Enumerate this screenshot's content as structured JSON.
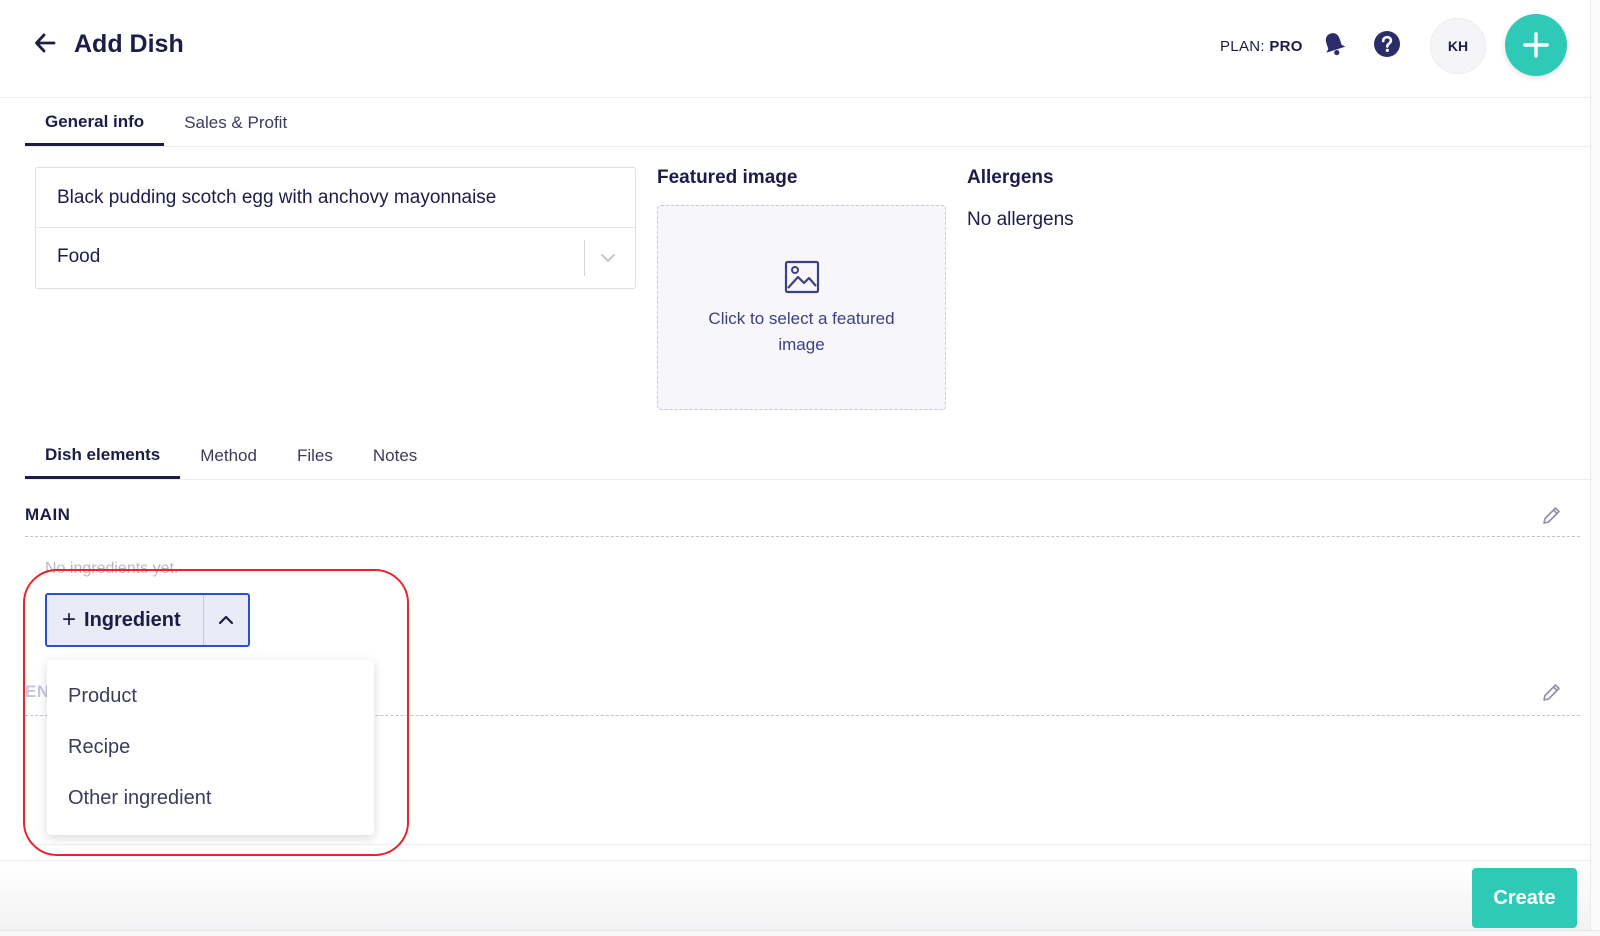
{
  "header": {
    "title": "Add Dish",
    "plan_label": "PLAN:",
    "plan_value": "PRO",
    "avatar_initials": "KH",
    "icons": [
      "back-arrow-icon",
      "bell-icon",
      "help-icon",
      "plus-icon"
    ]
  },
  "top_tabs": [
    {
      "label": "General info",
      "active": true
    },
    {
      "label": "Sales & Profit",
      "active": false
    }
  ],
  "form": {
    "dish_name": "Black pudding scotch egg with anchovy mayonnaise",
    "dish_type": "Food"
  },
  "featured_image": {
    "title": "Featured image",
    "prompt": "Click to select a featured image"
  },
  "allergens": {
    "title": "Allergens",
    "value": "No allergens"
  },
  "element_tabs": [
    {
      "label": "Dish elements",
      "active": true
    },
    {
      "label": "Method",
      "active": false
    },
    {
      "label": "Files",
      "active": false
    },
    {
      "label": "Notes",
      "active": false
    }
  ],
  "sections": {
    "main_title": "MAIN",
    "main_empty": "No ingredients yet.",
    "second_title": "EN"
  },
  "ingredient_button": {
    "label": "Ingredient",
    "menu": [
      "Product",
      "Recipe",
      "Other ingredient"
    ]
  },
  "footer": {
    "create_label": "Create"
  },
  "colors": {
    "accent": "#2ec9b7",
    "primary_text": "#1c1d47",
    "button_border": "#2a4fcf",
    "annotation": "#e8242c"
  }
}
